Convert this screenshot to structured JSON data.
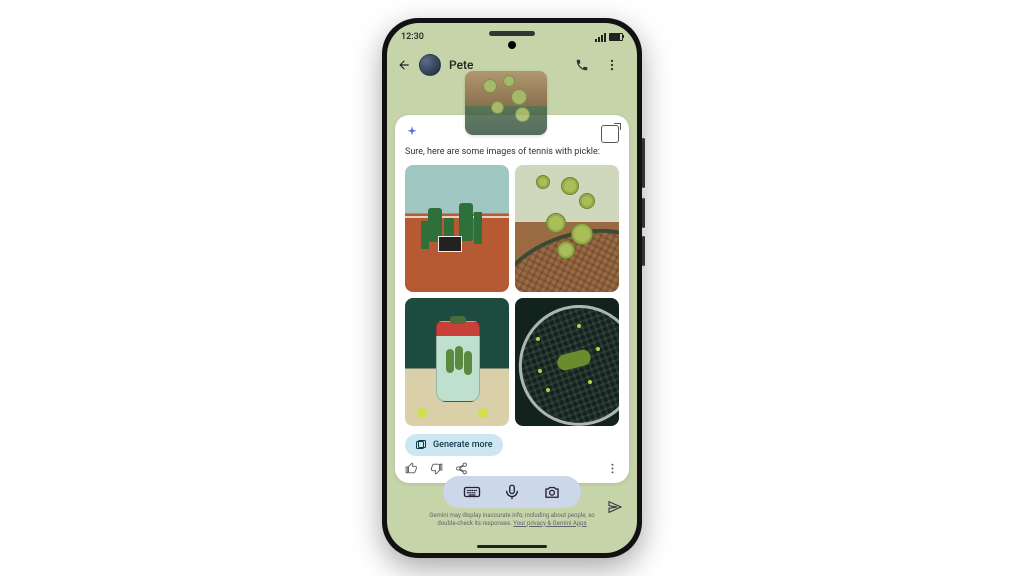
{
  "status": {
    "time": "12:30"
  },
  "header": {
    "contact_name": "Pete"
  },
  "card": {
    "response_text": "Sure, here are some images of tennis with pickle:",
    "generate_more_label": "Generate more"
  },
  "footer": {
    "disclaimer_line1": "Gemini may display inaccurate info, including about people, so",
    "disclaimer_line2": "double-check its responses.",
    "disclaimer_link": "Your privacy & Gemini Apps"
  }
}
